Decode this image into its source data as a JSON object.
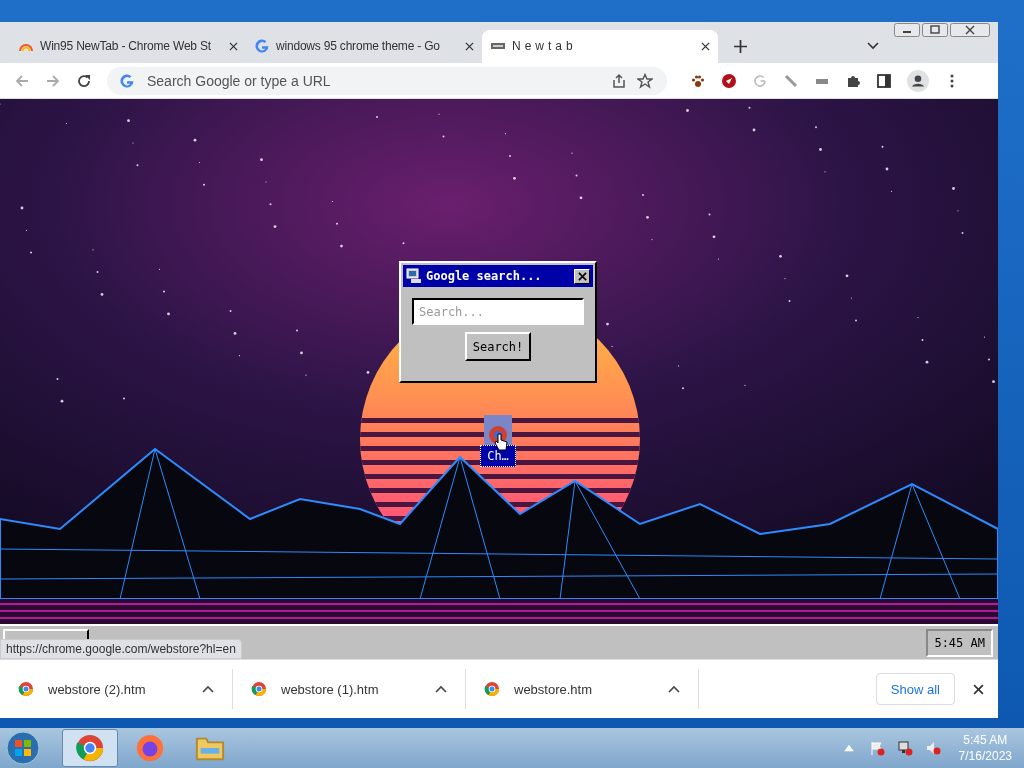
{
  "tabs": [
    {
      "title": "Win95 NewTab - Chrome Web St",
      "kind": "rainbow",
      "selected": false
    },
    {
      "title": "windows 95 chrome theme - Go",
      "kind": "google",
      "selected": false
    },
    {
      "title": "Newtab",
      "kind": "retro",
      "selected": true
    }
  ],
  "address_bar": {
    "placeholder": "Search Google or type a URL"
  },
  "page": {
    "dialog": {
      "title": "Google search...",
      "search": {
        "placeholder": "Search..."
      },
      "button": "Search!"
    },
    "shortcut": {
      "label": "Ch…"
    },
    "retro_taskbar": {
      "clock": "5:45 AM"
    }
  },
  "status_url": "https://chrome.google.com/webstore?hl=en",
  "downloads": {
    "items": [
      {
        "name": "webstore (2).htm"
      },
      {
        "name": "webstore (1).htm"
      },
      {
        "name": "webstore.htm"
      }
    ],
    "show_all": "Show all"
  },
  "taskbar": {
    "apps": [
      {
        "kind": "chrome",
        "selected": true
      },
      {
        "kind": "firefox",
        "selected": false
      },
      {
        "kind": "explorer",
        "selected": false
      }
    ],
    "time": "5:45 AM",
    "date": "7/16/2023"
  }
}
